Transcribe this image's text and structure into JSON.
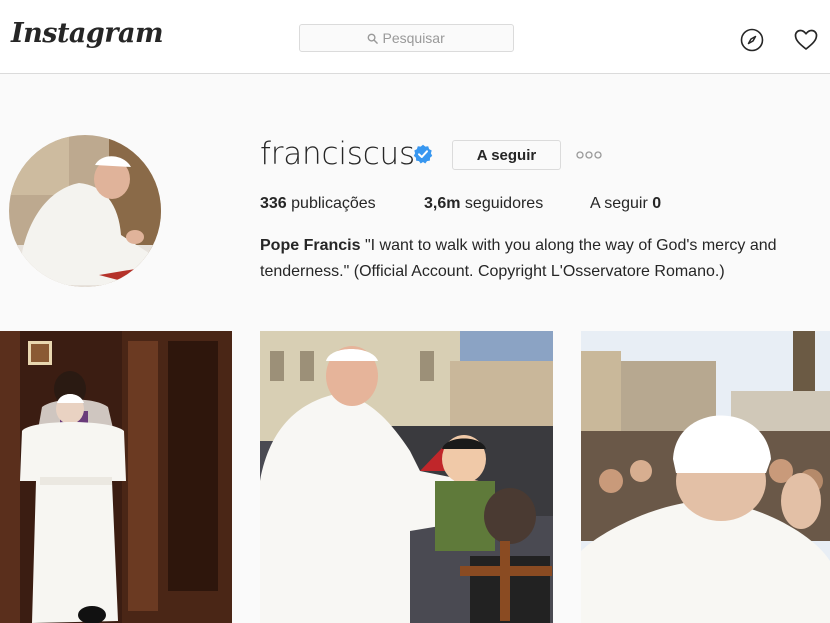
{
  "header": {
    "logo": "Instagram",
    "search": {
      "placeholder": "Pesquisar",
      "icon": "search-icon"
    },
    "icons": [
      "compass-icon",
      "heart-icon"
    ]
  },
  "profile": {
    "username": "franciscus",
    "verified": true,
    "follow_button": "A seguir",
    "more_icon": "ellipsis-icon",
    "stats": {
      "posts_count": "336",
      "posts_label": "publicações",
      "followers_count": "3,6m",
      "followers_label": "seguidores",
      "following_label": "A seguir",
      "following_count": "0"
    },
    "bio": {
      "name": "Pope Francis",
      "text": "\"I want to walk with you along the way of God's mercy and tenderness.\" (Official Account. Copyright L'Osservatore Romano.)"
    }
  },
  "colors": {
    "verified": "#3897f0",
    "border": "#dbdbdb",
    "text": "#262626"
  }
}
